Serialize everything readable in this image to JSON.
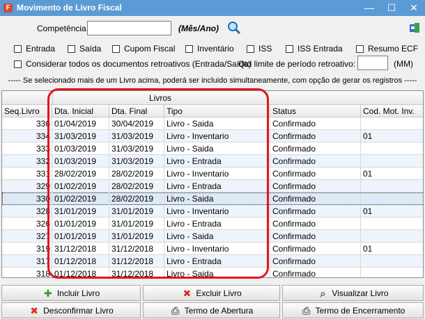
{
  "window": {
    "title": "Movimento de Livro Fiscal",
    "icon": "app-icon",
    "minimize": "—",
    "maximize": "☐",
    "close": "✕"
  },
  "filter": {
    "competencia_label": "Competência:",
    "competencia_value": "",
    "competencia_hint": "(Mês/Ano)",
    "search_icon": "search-icon",
    "export_icon": "export-icon"
  },
  "checkboxes": {
    "entrada": "Entrada",
    "saida": "Saída",
    "cupom_fiscal": "Cupom Fiscal",
    "inventario": "Inventário",
    "iss": "ISS",
    "iss_entrada": "ISS Entrada",
    "resumo_ecf": "Resumo ECF",
    "retroativos": "Considerar todos os documentos retroativos (Entrada/Saída)"
  },
  "qtd_limite": {
    "label": "Qtd limite de período retroativo:",
    "value": "",
    "unit": "(MM)"
  },
  "note": "-----  Se selecionado mais de um Livro acima, poderá ser incluido simultaneamente, com opção de gerar os registros  -----",
  "grid": {
    "group_header": "Livros",
    "columns": [
      "Seq.Livro",
      "Dta. Inicial",
      "Dta. Final",
      "Tipo",
      "Status",
      "Cod. Mot. Inv."
    ],
    "rows": [
      [
        "336",
        "01/04/2019",
        "30/04/2019",
        "Livro - Saida",
        "Confirmado",
        ""
      ],
      [
        "334",
        "31/03/2019",
        "31/03/2019",
        "Livro - Inventario",
        "Confirmado",
        "01"
      ],
      [
        "333",
        "01/03/2019",
        "31/03/2019",
        "Livro - Saida",
        "Confirmado",
        ""
      ],
      [
        "332",
        "01/03/2019",
        "31/03/2019",
        "Livro - Entrada",
        "Confirmado",
        ""
      ],
      [
        "331",
        "28/02/2019",
        "28/02/2019",
        "Livro - Inventario",
        "Confirmado",
        "01"
      ],
      [
        "329",
        "01/02/2019",
        "28/02/2019",
        "Livro - Entrada",
        "Confirmado",
        ""
      ],
      [
        "330",
        "01/02/2019",
        "28/02/2019",
        "Livro - Saida",
        "Confirmado",
        ""
      ],
      [
        "328",
        "31/01/2019",
        "31/01/2019",
        "Livro - Inventario",
        "Confirmado",
        "01"
      ],
      [
        "326",
        "01/01/2019",
        "31/01/2019",
        "Livro - Entrada",
        "Confirmado",
        ""
      ],
      [
        "327",
        "01/01/2019",
        "31/01/2019",
        "Livro - Saida",
        "Confirmado",
        ""
      ],
      [
        "319",
        "31/12/2018",
        "31/12/2018",
        "Livro - Inventario",
        "Confirmado",
        "01"
      ],
      [
        "317",
        "01/12/2018",
        "31/12/2018",
        "Livro - Entrada",
        "Confirmado",
        ""
      ],
      [
        "318",
        "01/12/2018",
        "31/12/2018",
        "Livro - Saida",
        "Confirmado",
        ""
      ]
    ],
    "selected_row": 6
  },
  "buttons": {
    "incluir": "Incluir Livro",
    "excluir": "Excluir Livro",
    "visualizar": "Visualizar Livro",
    "desconfirmar": "Desconfirmar Livro",
    "termo_abertura": "Termo de Abertura",
    "termo_encerramento": "Termo de Encerramento"
  },
  "colors": {
    "titlebar": "#5b9bd5",
    "highlight": "#e0141e",
    "alt_row": "#eef4fb",
    "selected_row": "#dce9f7"
  }
}
